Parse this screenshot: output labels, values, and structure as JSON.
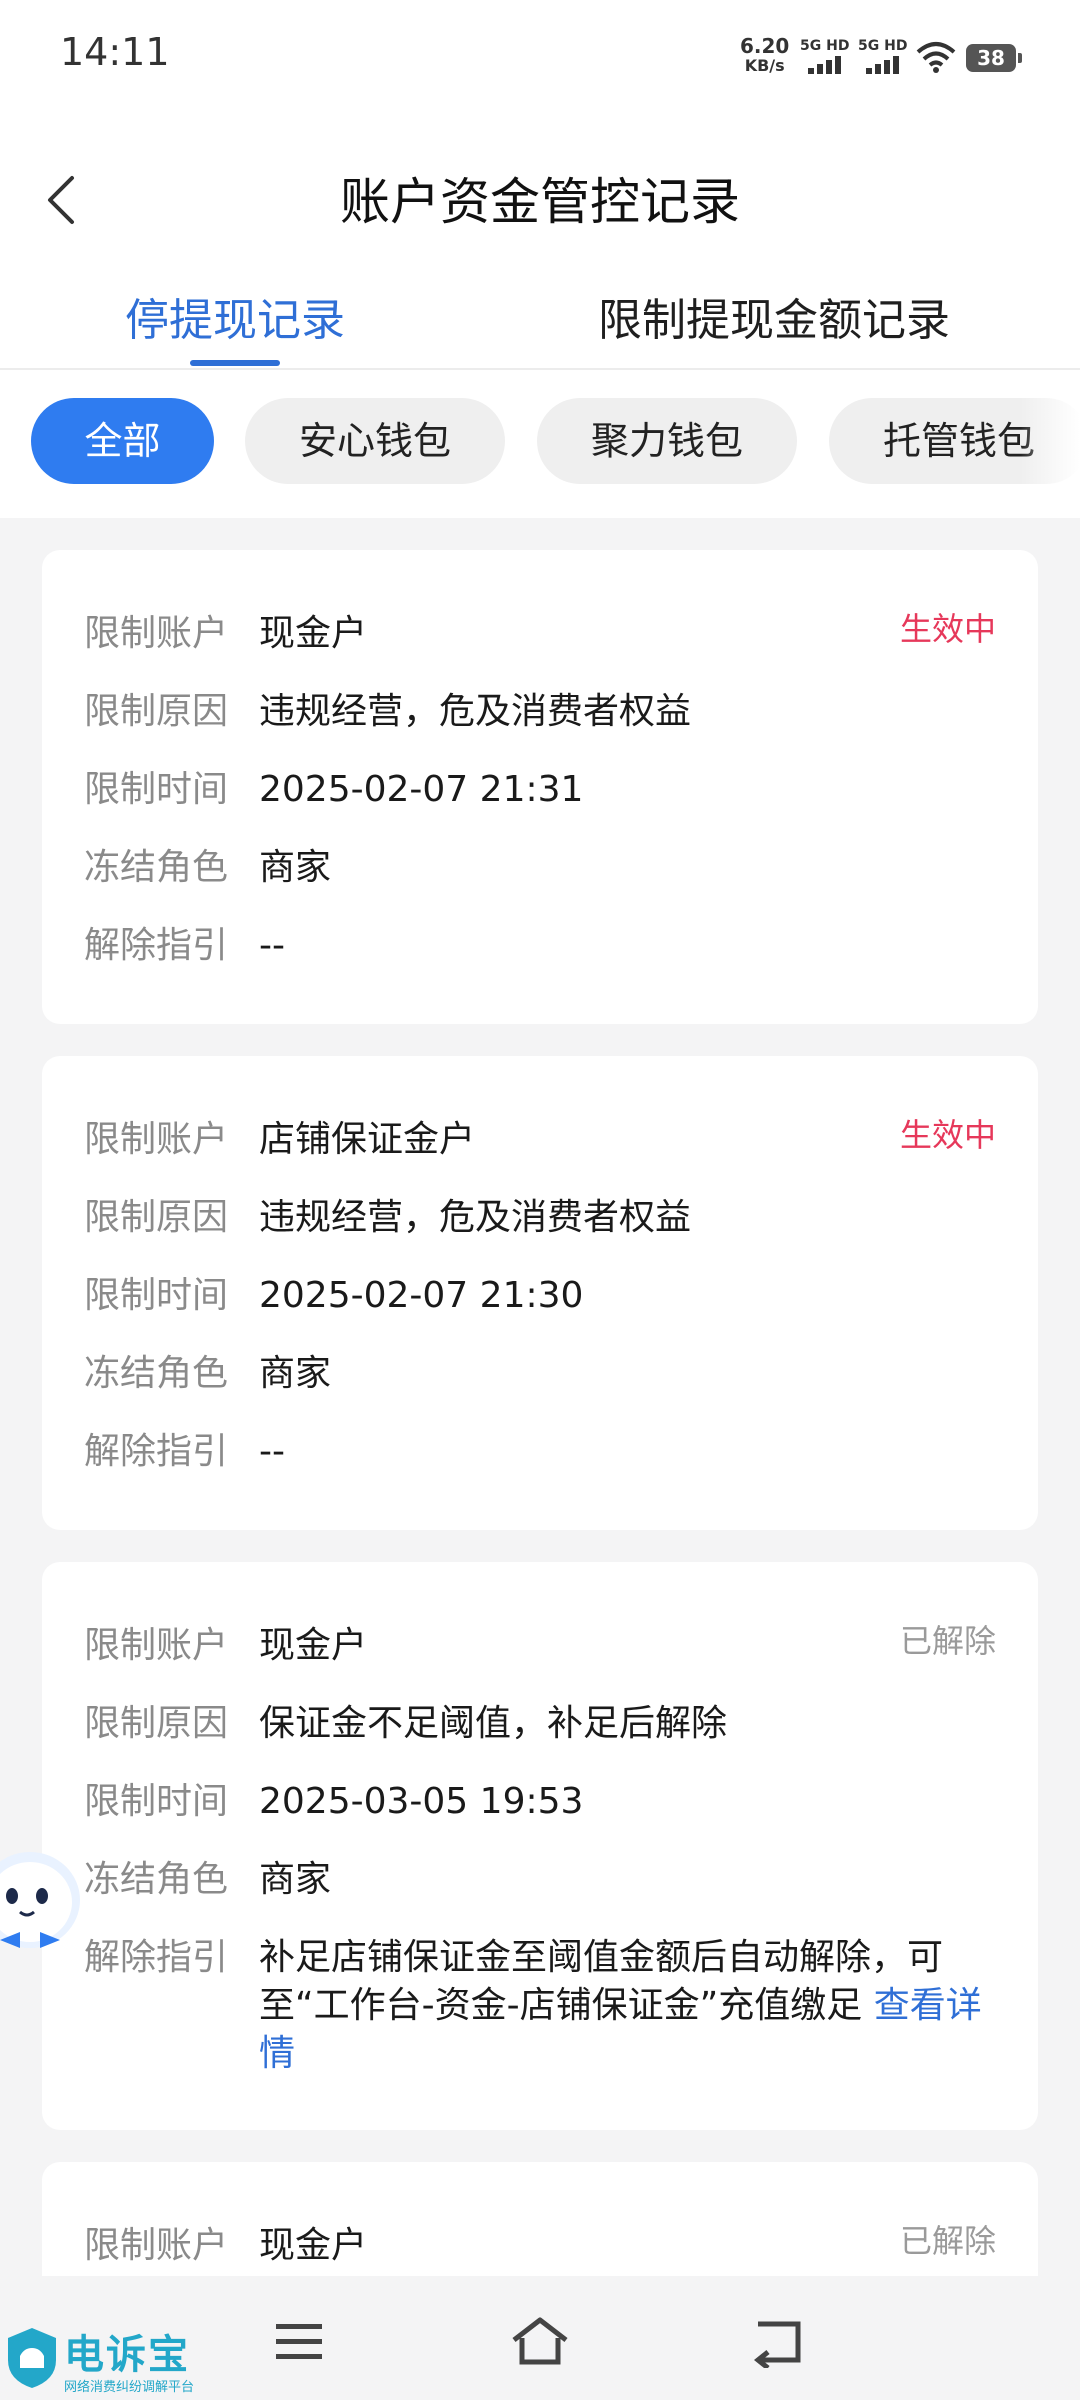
{
  "status_bar": {
    "time": "14:11",
    "net_speed": "6.20",
    "net_unit": "KB/s",
    "sim1": "5G HD",
    "sim2": "5G HD",
    "battery": "38"
  },
  "header": {
    "title": "账户资金管控记录",
    "back_icon": "chevron-left-icon"
  },
  "tabs": [
    {
      "label": "停提现记录",
      "active": true
    },
    {
      "label": "限制提现金额记录",
      "active": false
    }
  ],
  "filters": [
    {
      "label": "全部",
      "active": true
    },
    {
      "label": "安心钱包",
      "active": false
    },
    {
      "label": "聚力钱包",
      "active": false
    },
    {
      "label": "托管钱包",
      "active": false
    }
  ],
  "labels": {
    "account": "限制账户",
    "reason": "限制原因",
    "time": "限制时间",
    "role": "冻结角色",
    "guide": "解除指引"
  },
  "records": [
    {
      "status": "生效中",
      "account": "现金户",
      "reason": "违规经营，危及消费者权益",
      "time": "2025-02-07 21:31",
      "role": "商家",
      "guide": "--"
    },
    {
      "status": "生效中",
      "account": "店铺保证金户",
      "reason": "违规经营，危及消费者权益",
      "time": "2025-02-07 21:30",
      "role": "商家",
      "guide": "--"
    },
    {
      "status": "已解除",
      "account": "现金户",
      "reason": "保证金不足阈值，补足后解除",
      "time": "2025-03-05 19:53",
      "role": "商家",
      "guide": "补足店铺保证金至阈值金额后自动解除，可至“工作台-资金-店铺保证金”充值缴足",
      "guide_link": "查看详情"
    },
    {
      "status": "已解除",
      "account": "现金户"
    }
  ],
  "watermark": {
    "name": "电诉宝",
    "subtitle": "网络消费纠纷调解平台"
  },
  "colors": {
    "accent": "#2f6fd6",
    "chip_active": "#2f7cf0",
    "status_active": "#e6385a",
    "status_released": "#9a9a9a",
    "background": "#f4f4f5"
  }
}
